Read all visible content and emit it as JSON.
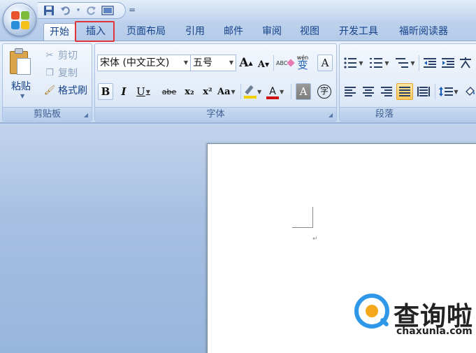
{
  "qat": {
    "save_icon": "save-icon",
    "undo_icon": "undo-icon",
    "redo_icon": "redo-icon",
    "print_preview_icon": "print-preview-icon",
    "customize_symbol": "="
  },
  "tabs": [
    {
      "label": "开始",
      "active": true
    },
    {
      "label": "插入",
      "active": false,
      "highlighted": true
    },
    {
      "label": "页面布局",
      "active": false
    },
    {
      "label": "引用",
      "active": false
    },
    {
      "label": "邮件",
      "active": false
    },
    {
      "label": "审阅",
      "active": false
    },
    {
      "label": "视图",
      "active": false
    },
    {
      "label": "开发工具",
      "active": false
    },
    {
      "label": "福昕阅读器",
      "active": false
    }
  ],
  "clipboard": {
    "paste_label": "粘贴",
    "cut_label": "剪切",
    "copy_label": "复制",
    "format_painter_label": "格式刷",
    "group_label": "剪贴板"
  },
  "font": {
    "font_name": "宋体 (中文正文)",
    "font_size": "五号",
    "grow_label": "A",
    "shrink_label": "A",
    "clear_format_label": "ABC",
    "phonetic_label": "wén",
    "phonetic_char": "变",
    "char_border_label": "A",
    "bold_label": "B",
    "italic_label": "I",
    "underline_label": "U",
    "strike_label": "abe",
    "subscript_label": "x₂",
    "superscript_label": "x²",
    "change_case_label": "Aa",
    "font_color_label": "A",
    "shading_label": "A",
    "enclose_label": "字",
    "group_label": "字体"
  },
  "paragraph": {
    "group_label": "段落"
  },
  "document": {
    "paragraph_mark": "↵"
  },
  "watermark": {
    "brand_cn": "查询啦",
    "brand_en": "chaxunla.com"
  },
  "colors": {
    "highlight_box": "#e0353b",
    "highlight_color": "#f0d000",
    "font_color": "#d01010"
  }
}
